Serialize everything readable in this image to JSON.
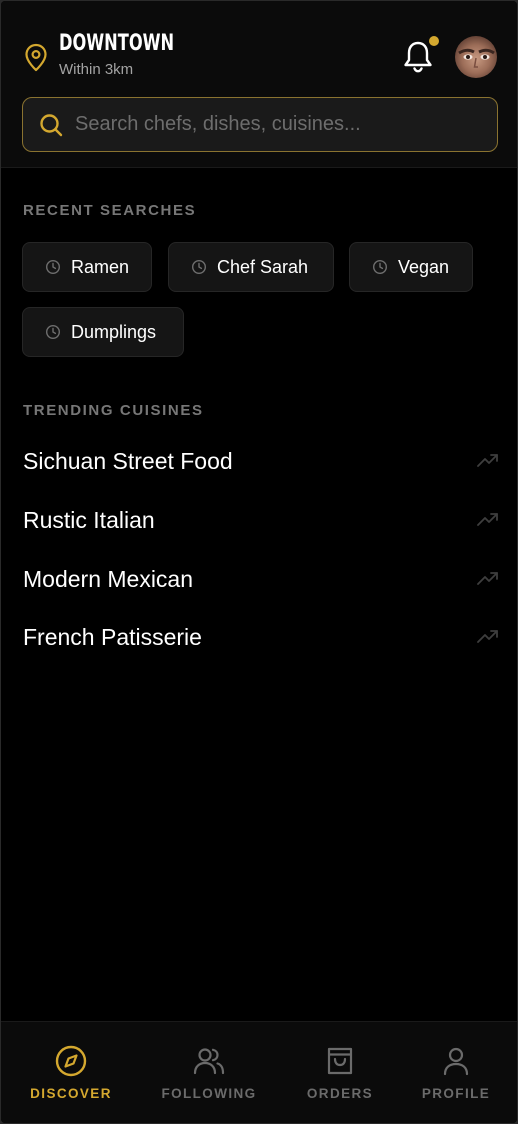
{
  "header": {
    "location_title": "DOWNTOWN",
    "location_subtitle": "Within 3km",
    "notification_dot": true
  },
  "search": {
    "placeholder": "Search chefs, dishes, cuisines...",
    "value": ""
  },
  "recent_searches": {
    "title": "RECENT SEARCHES",
    "items": [
      "Ramen",
      "Chef Sarah",
      "Vegan",
      "Dumplings"
    ]
  },
  "trending": {
    "title": "TRENDING CUISINES",
    "items": [
      "Sichuan Street Food",
      "Rustic Italian",
      "Modern Mexican",
      "French Patisserie"
    ]
  },
  "bottom_nav": {
    "items": [
      {
        "label": "DISCOVER",
        "icon": "compass-icon",
        "active": true
      },
      {
        "label": "FOLLOWING",
        "icon": "users-icon",
        "active": false
      },
      {
        "label": "ORDERS",
        "icon": "shopping-bag-icon",
        "active": false
      },
      {
        "label": "PROFILE",
        "icon": "user-icon",
        "active": false
      }
    ]
  },
  "colors": {
    "accent": "#d4a82f",
    "background": "#000000",
    "surface": "#151515",
    "muted_text": "#777777"
  }
}
